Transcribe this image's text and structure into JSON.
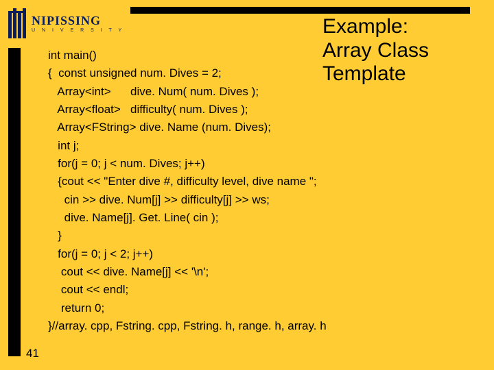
{
  "logo": {
    "name": "NIPISSING",
    "sub": "U N I V E R S I T Y"
  },
  "title": {
    "line1": "Example:",
    "line2": "Array Class",
    "line3": "Template"
  },
  "code": {
    "l1": "int main()",
    "l2": "{  const unsigned num. Dives = 2;",
    "l3": "   Array<int>      dive. Num( num. Dives );",
    "l4": "   Array<float>   difficulty( num. Dives );",
    "l5": "   Array<FString> dive. Name (num. Dives);",
    "l6": "   int j;",
    "l7": "   for(j = 0; j < num. Dives; j++)",
    "l8": "   {cout << \"Enter dive #, difficulty level, dive name \";",
    "l9": "     cin >> dive. Num[j] >> difficulty[j] >> ws;",
    "l10": "     dive. Name[j]. Get. Line( cin );",
    "l11": "   }",
    "l12": "   for(j = 0; j < 2; j++)",
    "l13": "    cout << dive. Name[j] << '\\n';",
    "l14": "    cout << endl;",
    "l15": "    return 0;",
    "l16": "}//array. cpp, Fstring. cpp, Fstring. h, range. h, array. h"
  },
  "page_number": "41"
}
